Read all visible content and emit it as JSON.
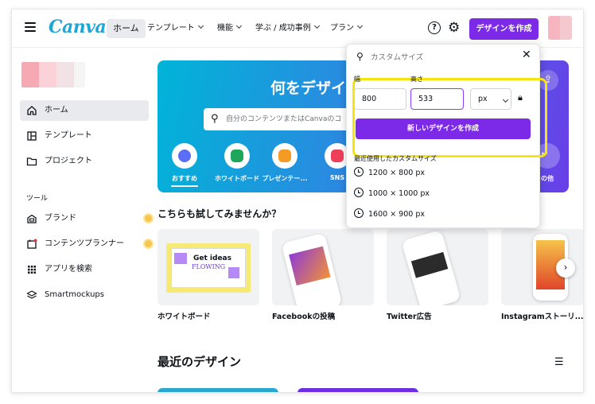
{
  "topbar": {
    "logo": "Canva",
    "nav": [
      {
        "label": "ホーム"
      },
      {
        "label": "テンプレート"
      },
      {
        "label": "機能"
      },
      {
        "label": "学ぶ / 成功事例"
      },
      {
        "label": "プラン"
      }
    ],
    "help_icon": "question-circle-icon",
    "settings_icon": "gear-icon",
    "create_label": "デザインを作成"
  },
  "sidebar": {
    "items": [
      {
        "label": "ホーム",
        "icon": "home-icon"
      },
      {
        "label": "テンプレート",
        "icon": "template-icon"
      },
      {
        "label": "プロジェクト",
        "icon": "folder-icon"
      }
    ],
    "section": "ツール",
    "tools": [
      {
        "label": "ブランド",
        "icon": "brand-icon"
      },
      {
        "label": "コンテンツプランナー",
        "icon": "calendar-icon"
      },
      {
        "label": "アプリを検索",
        "icon": "apps-grid-icon"
      },
      {
        "label": "Smartmockups",
        "icon": "layers-icon"
      }
    ]
  },
  "hero": {
    "title": "何をデザイ",
    "search_placeholder": "自分のコンテンツまたはCanvaのコ",
    "categories": [
      {
        "label": "おすすめ",
        "icon": "sparkle-icon"
      },
      {
        "label": "ホワイトボード",
        "icon": "whiteboard-icon"
      },
      {
        "label": "プレゼンテー...",
        "icon": "presentation-icon"
      },
      {
        "label": "SNS",
        "icon": "heart-icon"
      },
      {
        "label": "の他",
        "icon": "more-icon"
      }
    ]
  },
  "suggest": {
    "title": "こちらも試してみませんか？",
    "cards": [
      {
        "label": "ホワイトボード",
        "thumb_text": "Get ideas",
        "thumb_text2": "FLOWING"
      },
      {
        "label": "Facebookの投稿"
      },
      {
        "label": "Twitter広告"
      },
      {
        "label": "Instagramストーリ..."
      }
    ]
  },
  "recent": {
    "title": "最近のデザイン"
  },
  "popup": {
    "search_placeholder": "カスタムサイズ",
    "width_label": "幅",
    "height_label": "高さ",
    "width_value": "800",
    "height_value": "533",
    "unit": "px",
    "create_label": "新しいデザインを作成",
    "recent_header": "最近使用したカスタムサイズ",
    "recent_sizes": [
      "1200 × 800 px",
      "1000 × 1000 px",
      "1600 × 900 px"
    ],
    "highlight_color": "#f5e50f"
  },
  "colors": {
    "brand_purple": "#7d2ae8",
    "canva_blue": "#20a6d6"
  }
}
